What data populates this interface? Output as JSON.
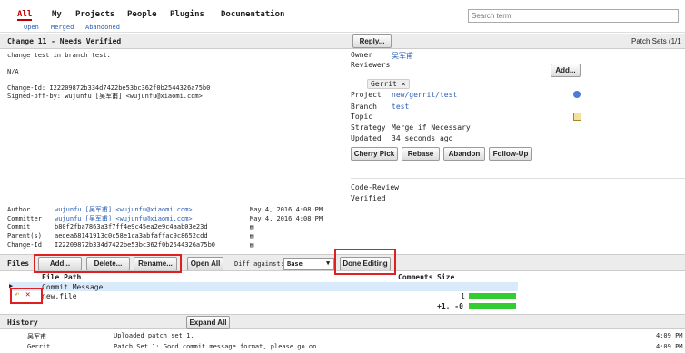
{
  "topnav": {
    "items": [
      "All",
      "My",
      "Projects",
      "People",
      "Plugins",
      "Documentation"
    ],
    "subitems": [
      "Open",
      "Merged",
      "Abandoned"
    ],
    "search_placeholder": "Search term"
  },
  "change": {
    "title": "Change 11 - Needs Verified",
    "message": [
      "change test in branch test.",
      "",
      "N/A",
      "",
      "Change-Id: I22209872b334d7422be53bc362f0b2544326a75b0",
      "Signed-off-by: wujunfu [吴军甫] <wujunfu@xiaomi.com>"
    ],
    "reply_label": "Reply...",
    "patch_sets_label": "Patch Sets (1/1"
  },
  "info": {
    "owner_label": "Owner",
    "owner_value": "吴军甫",
    "reviewers_label": "Reviewers",
    "add_label": "Add...",
    "reviewer_chip": "Gerrit ×",
    "project_label": "Project",
    "project_value": "new/gerrit/test",
    "branch_label": "Branch",
    "branch_value": "test",
    "topic_label": "Topic",
    "strategy_label": "Strategy",
    "strategy_value": "Merge if Necessary",
    "updated_label": "Updated",
    "updated_value": "34 seconds ago",
    "actions": [
      "Cherry Pick",
      "Rebase",
      "Abandon",
      "Follow-Up"
    ],
    "labels": [
      "Code-Review",
      "Verified"
    ]
  },
  "commit": {
    "rows": [
      {
        "label": "Author",
        "value": "wujunfu [吴军甫] <wujunfu@xiaomi.com>",
        "date": "May 4, 2016 4:08 PM"
      },
      {
        "label": "Committer",
        "value": "wujunfu [吴军甫] <wujunfu@xiaomi.com>",
        "date": "May 4, 2016 4:08 PM"
      },
      {
        "label": "Commit",
        "value": "b80f2fba7863a3f7ff4e9c45ea2e9c4aab03e23d",
        "date": ""
      },
      {
        "label": "Parent(s)",
        "value": "aedea68141913c0c58e1ca3abfaffac9c8652cdd",
        "date": ""
      },
      {
        "label": "Change-Id",
        "value": "I22209872b334d7422be53bc362f0b2544326a75b0",
        "date": ""
      }
    ]
  },
  "files": {
    "label": "Files",
    "add": "Add...",
    "delete": "Delete...",
    "rename": "Rename...",
    "open_all": "Open All",
    "diff_against": "Diff against:",
    "diff_value": "Base",
    "done_editing": "Done Editing",
    "col_path": "File Path",
    "col_comments": "Comments",
    "col_size": "Size",
    "commit_message": "Commit Message",
    "file_name": "new.file",
    "file_size": "1",
    "total": "+1, -0"
  },
  "history": {
    "label": "History",
    "expand_all": "Expand All",
    "entries": [
      {
        "author": "吴军甫",
        "message": "Uploaded patch set 1.",
        "time": "4:09 PM"
      },
      {
        "author": "Gerrit",
        "message": "Patch Set 1: Good commit message format, please go on.",
        "time": "4:09 PM"
      }
    ]
  },
  "colors": {
    "link": "#2a5db0",
    "highlight": "#d9ebfb",
    "header": "#ececec",
    "red": "#e02020",
    "green": "#33cc33"
  }
}
